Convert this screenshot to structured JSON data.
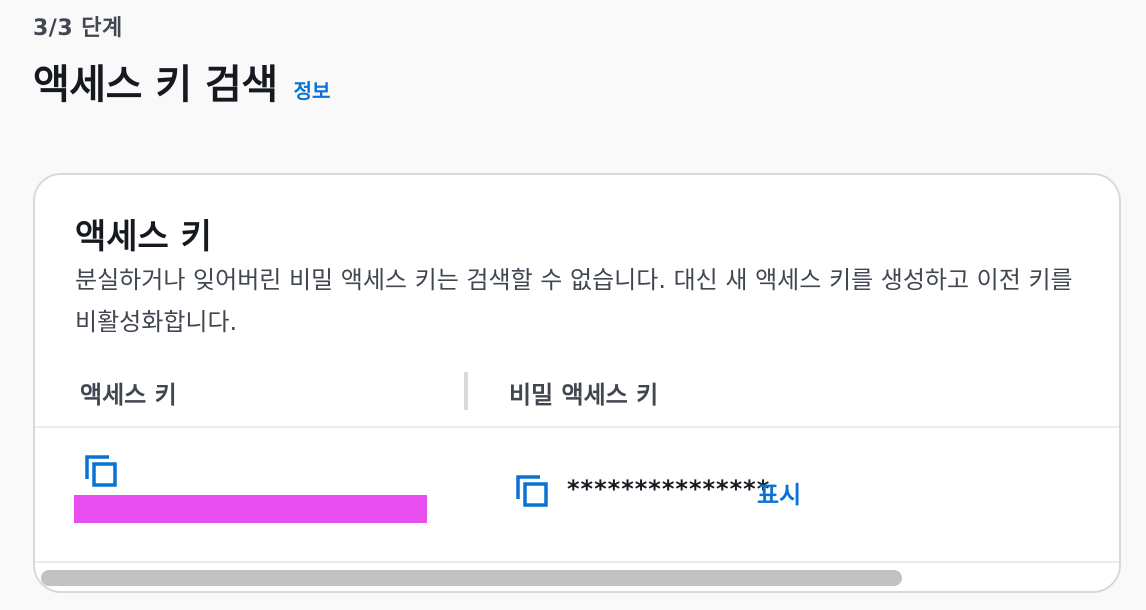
{
  "header": {
    "step": "3/3 단계",
    "title": "액세스 키 검색",
    "info_link": "정보"
  },
  "card": {
    "title": "액세스 키",
    "description": "분실하거나 잊어버린 비밀 액세스 키는 검색할 수 없습니다. 대신 새 액세스 키를 생성하고 이전 키를 비활성화합니다."
  },
  "table": {
    "columns": [
      "액세스 키",
      "비밀 액세스 키"
    ],
    "secret_masked": "***************",
    "show_label": "표시"
  },
  "colors": {
    "link": "#0972d3",
    "redaction": "#e94ff0"
  },
  "icons": [
    "copy-icon",
    "copy-icon"
  ]
}
